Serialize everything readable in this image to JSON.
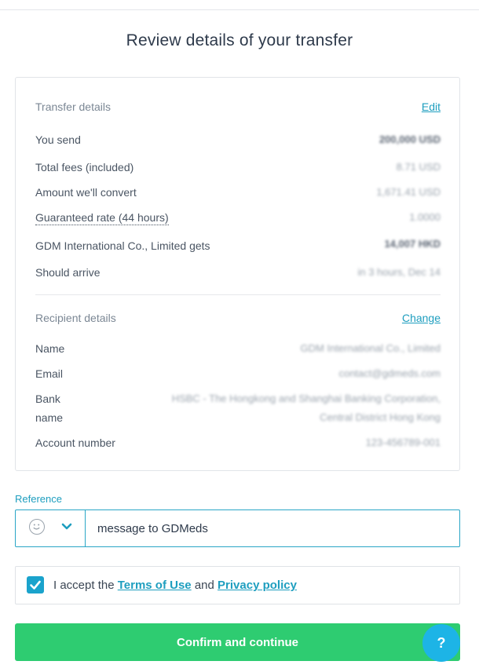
{
  "page": {
    "title": "Review details of your transfer"
  },
  "transfer": {
    "heading": "Transfer details",
    "edit_label": "Edit",
    "rows": [
      {
        "label": "You send",
        "value": "200,000 USD"
      },
      {
        "label": "Total fees (included)",
        "value": "8.71 USD"
      },
      {
        "label": "Amount we'll convert",
        "value": "1,671.41 USD"
      },
      {
        "label": "Guaranteed rate (44 hours)",
        "value": "1.0000"
      },
      {
        "label": "GDM International Co., Limited gets",
        "value": "14,007 HKD"
      },
      {
        "label": "Should arrive",
        "value": "in 3 hours, Dec 14"
      }
    ]
  },
  "recipient": {
    "heading": "Recipient details",
    "change_label": "Change",
    "name_label": "Name",
    "name_value": "GDM International Co., Limited",
    "email_label": "Email",
    "email_value": "contact@gdmeds.com",
    "bank_label_1": "Bank",
    "bank_label_2": "name",
    "bank_value_1": "HSBC - The Hongkong and Shanghai Banking Corporation,",
    "bank_value_2": "Central District Hong Kong",
    "account_label": "Account number",
    "account_value": "123-456789-001"
  },
  "reference": {
    "label": "Reference",
    "value": "message to GDMeds"
  },
  "terms": {
    "prefix": "I accept the",
    "terms_link": "Terms of Use",
    "and": "and",
    "privacy_link": "Privacy policy"
  },
  "actions": {
    "confirm_label": "Confirm and continue",
    "help_label": "?"
  },
  "colors": {
    "accent": "#1e9ebf",
    "confirm_green": "#2ecc71",
    "help_blue": "#1db4e6"
  }
}
